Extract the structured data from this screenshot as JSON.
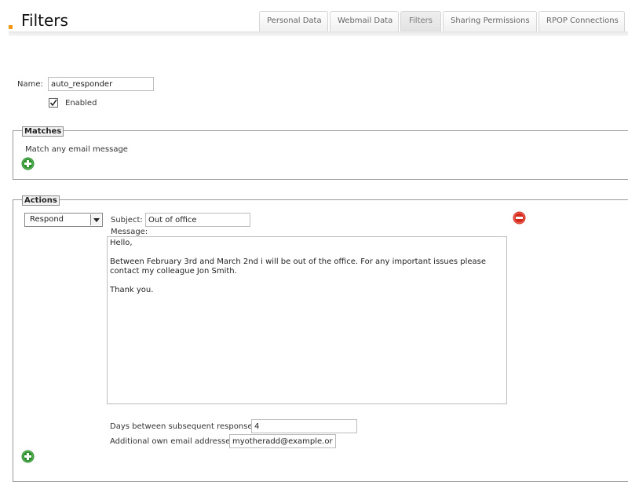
{
  "header": {
    "title": "Filters",
    "tabs": [
      {
        "label": "Personal Data"
      },
      {
        "label": "Webmail Data"
      },
      {
        "label": "Filters"
      },
      {
        "label": "Sharing Permissions"
      },
      {
        "label": "RPOP Connections"
      }
    ],
    "active_tab": "Filters"
  },
  "form": {
    "name_label": "Name:",
    "name_value": "auto_responder",
    "enabled_label": "Enabled",
    "enabled_checked": true
  },
  "matches": {
    "legend": "Matches",
    "description": "Match any email message",
    "add_icon": "plus-circle-icon"
  },
  "actions": {
    "legend": "Actions",
    "action_select_value": "Respond",
    "subject_label": "Subject:",
    "subject_value": "Out of office",
    "message_label": "Message:",
    "message_value": "Hello,\n\nBetween February 3rd and March 2nd i will be out of the office. For any important issues please contact my colleague Jon Smith.\n\nThank you.",
    "days_label": "Days between subsequent responses:",
    "days_value": "4",
    "addresses_label": "Additional own email addresses:",
    "addresses_value": "myotheradd@example.org",
    "remove_icon": "minus-circle-icon",
    "add_icon": "plus-circle-icon"
  },
  "colors": {
    "accent": "#f19914",
    "add_green": "#2e8b2e",
    "remove_red": "#d42a1e"
  }
}
